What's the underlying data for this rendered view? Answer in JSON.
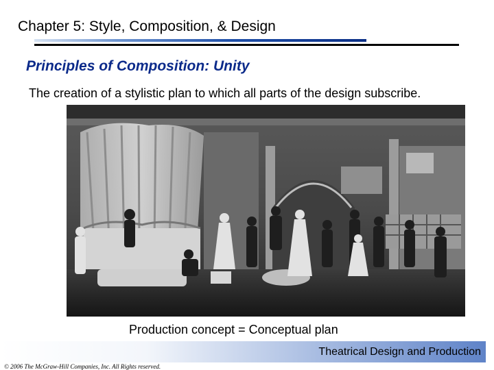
{
  "header": {
    "chapter_title": "Chapter 5:  Style, Composition, & Design"
  },
  "slide": {
    "section_title": "Principles of Composition:  Unity",
    "subtitle": "The creation of a stylistic plan to which all parts of the design subscribe.",
    "caption": "Production concept = Conceptual plan"
  },
  "footer": {
    "book_title": "Theatrical Design and Production",
    "copyright": "© 2006 The McGraw-Hill Companies, Inc. All Rights reserved."
  },
  "colors": {
    "section_title": "#0b2a8a",
    "rule_blue": "#1f4fa8",
    "footer_gradient_end": "#5f83c8"
  }
}
